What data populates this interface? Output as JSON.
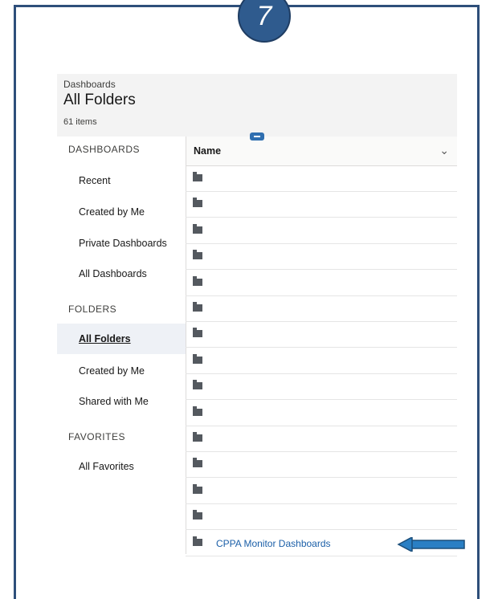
{
  "step": "7",
  "header": {
    "breadcrumb": "Dashboards",
    "title": "All Folders",
    "count": "61 items"
  },
  "sidebar": {
    "dashboards_heading": "DASHBOARDS",
    "dashboards": [
      "Recent",
      "Created by Me",
      "Private Dashboards",
      "All Dashboards"
    ],
    "folders_heading": "FOLDERS",
    "folders": [
      "All Folders",
      "Created by Me",
      "Shared with Me"
    ],
    "favorites_heading": "FAVORITES",
    "favorites": [
      "All Favorites"
    ]
  },
  "table": {
    "column": "Name",
    "rows": [
      "",
      "",
      "",
      "",
      "",
      "",
      "",
      "",
      "",
      "",
      "",
      "",
      "",
      "",
      "CPPA Monitor Dashboards"
    ]
  },
  "colors": {
    "frame": "#2e4f7a",
    "link": "#1b5fa8",
    "arrow": "#2a7fc4"
  }
}
